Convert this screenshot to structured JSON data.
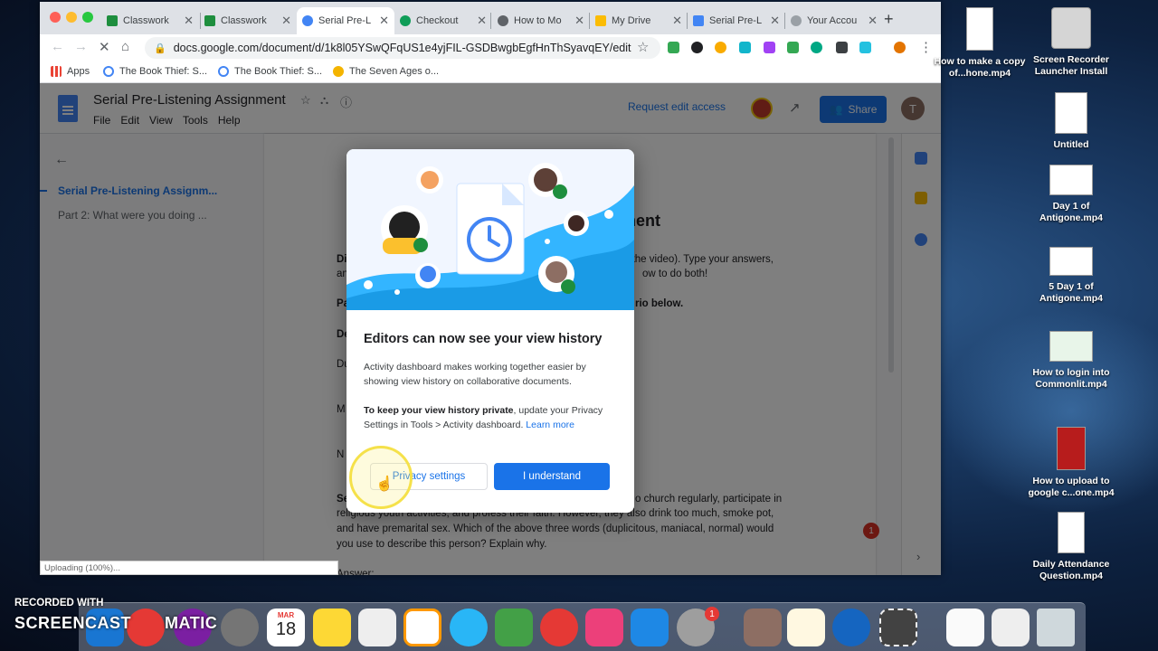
{
  "browser": {
    "tabs": [
      {
        "label": "Classwork",
        "icon": "classroom-icon",
        "color": "#1e8e3e"
      },
      {
        "label": "Classwork",
        "icon": "classroom-icon",
        "color": "#1e8e3e"
      },
      {
        "label": "Serial Pre-L",
        "icon": "docs-icon",
        "color": "#4285f4",
        "active": true
      },
      {
        "label": "Checkout",
        "icon": "checkout-icon",
        "color": "#0f9d58"
      },
      {
        "label": "How to Mo",
        "icon": "globe-icon",
        "color": "#5f6368"
      },
      {
        "label": "My Drive",
        "icon": "drive-icon",
        "color": "#fbbc04"
      },
      {
        "label": "Serial Pre-L",
        "icon": "docs-icon",
        "color": "#4285f4"
      },
      {
        "label": "Your Accou",
        "icon": "account-icon",
        "color": "#9aa0a6"
      }
    ],
    "url": "docs.google.com/document/d/1k8l05YSwQFqUS1e4yjFIL-GSDBwgbEgfHnThSyavqEY/edit",
    "bookmarks": [
      {
        "label": "Apps",
        "icon": "apps-grid-icon"
      },
      {
        "label": "The Book Thief: S...",
        "icon": "google-icon"
      },
      {
        "label": "The Book Thief: S...",
        "icon": "google-icon"
      },
      {
        "label": "The Seven Ages o...",
        "icon": "mask-icon"
      }
    ]
  },
  "docs": {
    "title": "Serial Pre-Listening Assignment",
    "menu": [
      "File",
      "Edit",
      "View",
      "Tools",
      "Help"
    ],
    "request_edit": "Request edit access",
    "share": "Share",
    "user_initial": "T",
    "outline": [
      "Serial Pre-Listening Assignm...",
      "Part 2: What were you doing ..."
    ],
    "comment_count": "1",
    "page": {
      "heading_fragment": "signment",
      "line1_left": "Di",
      "line1_right": "n the video).  Type your answers,",
      "line2_left": "an",
      "line2_right": "ow to do both!",
      "part_left": "Pa",
      "part_right": "rio below.",
      "de": "De",
      "du": "Du",
      "m": "M",
      "n": "N",
      "se": "Se",
      "para1_right": "o church regularly, participate in",
      "para2": "religious youth activities, and profess their faith. However, they also drink too much, smoke pot,",
      "para3": "and have premarital sex. Which of the above three words (duplicitous, maniacal, normal) would",
      "para4": "you use to describe this person?  Explain why.",
      "answer": "Answer:"
    }
  },
  "dialog": {
    "title": "Editors can now see your view history",
    "body1": "Activity dashboard makes working together easier by showing view history on collaborative documents.",
    "body2_bold": "To keep your view history private",
    "body2_rest": ", update your Privacy Settings in Tools > Activity dashboard. ",
    "learn_more": "Learn more",
    "secondary_button": "Privacy settings",
    "primary_button": "I understand"
  },
  "status": {
    "upload": "Uploading (100%)..."
  },
  "desktop": {
    "icons": [
      {
        "label": "How to make a copy of...hone.mp4"
      },
      {
        "label": "Screen Recorder Launcher Install"
      },
      {
        "label": "Untitled"
      },
      {
        "label": "Day 1 of Antigone.mp4"
      },
      {
        "label": "5 Day 1 of Antigone.mp4"
      },
      {
        "label": "How to login into Commonlit.mp4"
      },
      {
        "label": "How to upload to google c...one.mp4"
      },
      {
        "label": "Daily Attendance Question.mp4"
      }
    ]
  },
  "dock": {
    "calendar_month": "MAR",
    "calendar_day": "18",
    "prefs_badge": "1"
  },
  "watermark": {
    "line1": "RECORDED WITH",
    "line2": "SCREENCAST",
    "line3": "MATIC"
  },
  "colors": {
    "accent": "#1a73e8",
    "dialog_bg": "#ffffff",
    "hero_blue": "#33b5ff"
  }
}
